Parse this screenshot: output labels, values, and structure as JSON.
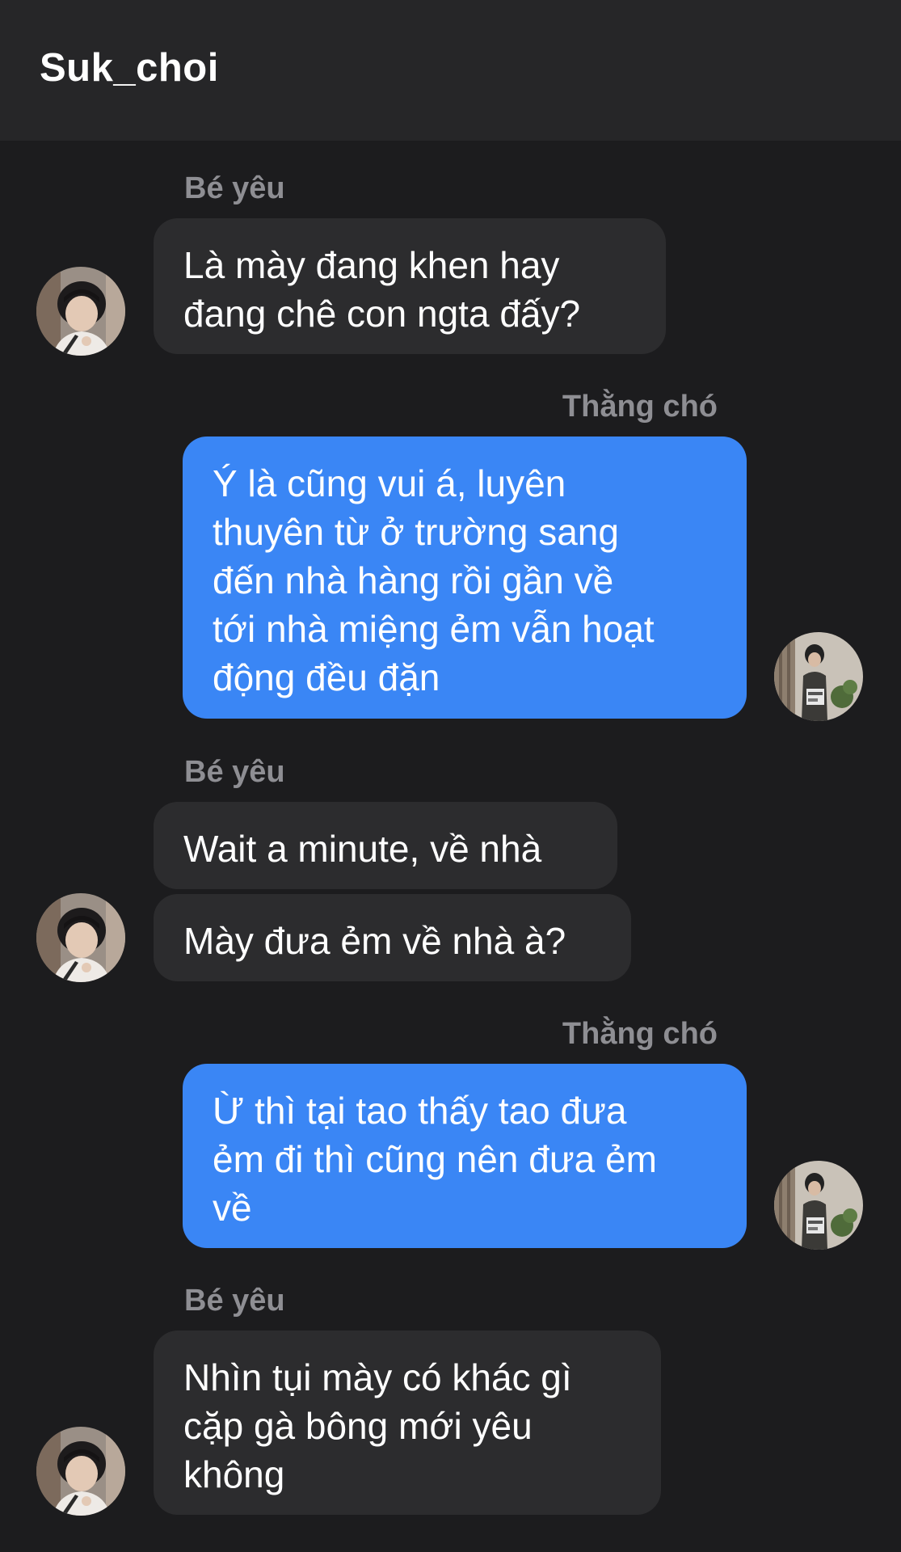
{
  "header": {
    "title": "Suk_choi"
  },
  "contacts": {
    "other": "Bé yêu",
    "me": "Thằng chó"
  },
  "messages": [
    {
      "sender": "Bé yêu",
      "text": "Là mày đang khen hay\nđang chê con ngta đấy?"
    },
    {
      "sender": "Thằng chó",
      "text": "Ý là cũng vui á, luyên\nthuyên từ ở trường sang\nđến nhà hàng rồi gần về\ntới nhà miệng ẻm vẫn hoạt\nđộng đều đặn"
    },
    {
      "sender": "Bé yêu",
      "text": "Wait a minute, về nhà"
    },
    {
      "sender": "Bé yêu",
      "text": "Mày đưa ẻm về nhà à?"
    },
    {
      "sender": "Thằng chó",
      "text": "Ừ thì tại tao thấy tao đưa\nẻm đi thì cũng nên đưa ẻm\nvề"
    },
    {
      "sender": "Bé yêu",
      "text": "Nhìn tụi mày có khác gì\ncặp gà bông mới yêu\nkhông"
    }
  ],
  "colors": {
    "background": "#1c1c1e",
    "header_bg": "#262628",
    "incoming_bubble": "#2c2c2e",
    "outgoing_bubble": "#3a86f5",
    "sender_label": "#8e8e93",
    "text": "#ffffff"
  },
  "icons": {
    "incoming_avatar": "avatar-be-yeu",
    "outgoing_avatar": "avatar-thang-cho"
  }
}
